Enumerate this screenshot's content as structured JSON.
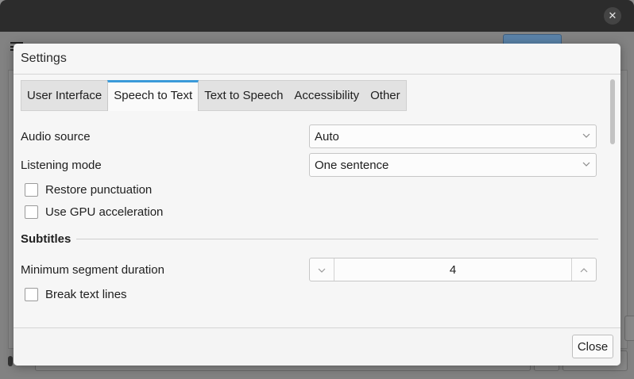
{
  "background_window": {
    "close_glyph": "✕"
  },
  "dialog": {
    "title": "Settings",
    "tabs": [
      {
        "label": "User Interface",
        "active": false
      },
      {
        "label": "Speech to Text",
        "active": true
      },
      {
        "label": "Text to Speech",
        "active": false
      },
      {
        "label": "Accessibility",
        "active": false
      },
      {
        "label": "Other",
        "active": false
      }
    ],
    "audio_source": {
      "label": "Audio source",
      "value": "Auto"
    },
    "listening_mode": {
      "label": "Listening mode",
      "value": "One sentence"
    },
    "restore_punctuation": {
      "label": "Restore punctuation",
      "checked": false
    },
    "use_gpu": {
      "label": "Use GPU acceleration",
      "checked": false
    },
    "subtitles_section": {
      "title": "Subtitles"
    },
    "min_segment_duration": {
      "label": "Minimum segment duration",
      "value": "4"
    },
    "break_text_lines": {
      "label": "Break text lines",
      "checked": false
    },
    "close_label": "Close"
  },
  "colors": {
    "accent": "#3a9ad9",
    "titlebar": "#2c2c2c",
    "dialog_bg": "#f6f6f6"
  }
}
